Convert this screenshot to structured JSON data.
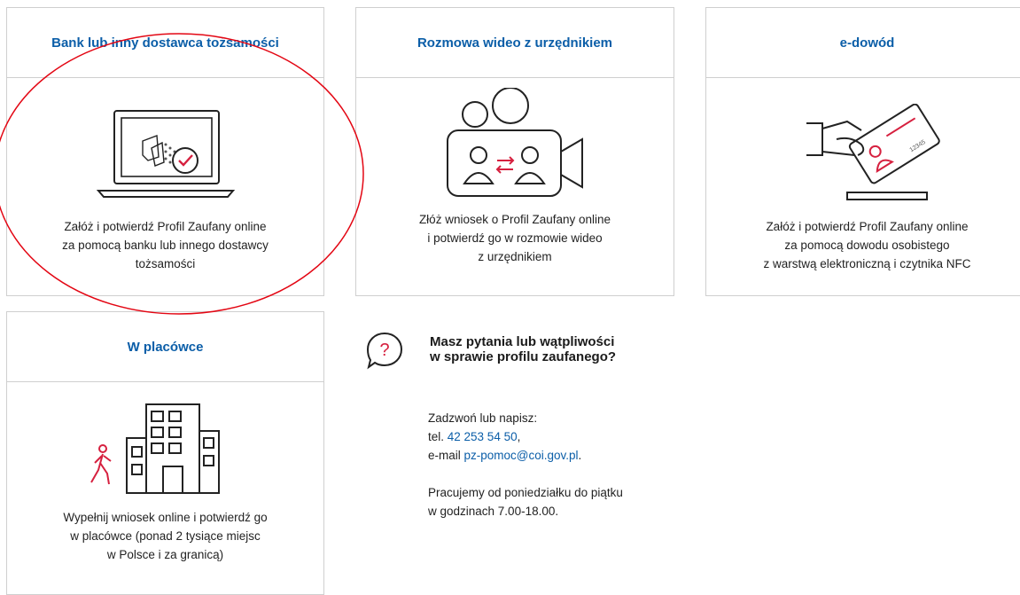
{
  "cards": [
    {
      "title": "Bank lub inny dostawca tożsamości",
      "icon": "laptop-check-icon",
      "lines": [
        "Załóż i potwierdź Profil Zaufany online",
        "za pomocą banku lub innego dostawcy",
        "tożsamości"
      ]
    },
    {
      "title": "Rozmowa wideo z urzędnikiem",
      "icon": "video-call-icon",
      "lines": [
        "Złóż wniosek o Profil Zaufany online",
        "i potwierdź go w rozmowie wideo",
        "z urzędnikiem"
      ]
    },
    {
      "title": "e-dowód",
      "icon": "id-card-hand-icon",
      "card_number": "12345",
      "lines": [
        "Załóż i potwierdź Profil Zaufany online",
        "za pomocą dowodu osobistego",
        "z warstwą elektroniczną i czytnika NFC"
      ]
    },
    {
      "title": "W placówce",
      "icon": "office-building-icon",
      "lines": [
        "Wypełnij wniosek online i potwierdź go",
        "w placówce (ponad 2 tysiące miejsc",
        "w Polsce i za granicą)"
      ]
    }
  ],
  "help": {
    "icon": "question-bubble-icon",
    "title_lines": [
      "Masz pytania lub wątpliwości",
      "w sprawie profilu zaufanego?"
    ],
    "contact_intro": "Zadzwoń lub napisz:",
    "phone_prefix": "tel. ",
    "phone": "42 253 54 50",
    "phone_suffix": ",",
    "email_prefix": "e-mail ",
    "email": "pz-pomoc@coi.gov.pl",
    "email_suffix": ".",
    "hours_line1": "Pracujemy od poniedziałku do piątku",
    "hours_line2": "w godzinach 7.00-18.00."
  },
  "colors": {
    "link": "#0b5ea8",
    "accent_red": "#d6203f",
    "border": "#cfcfcf",
    "annotation": "#e30613"
  }
}
